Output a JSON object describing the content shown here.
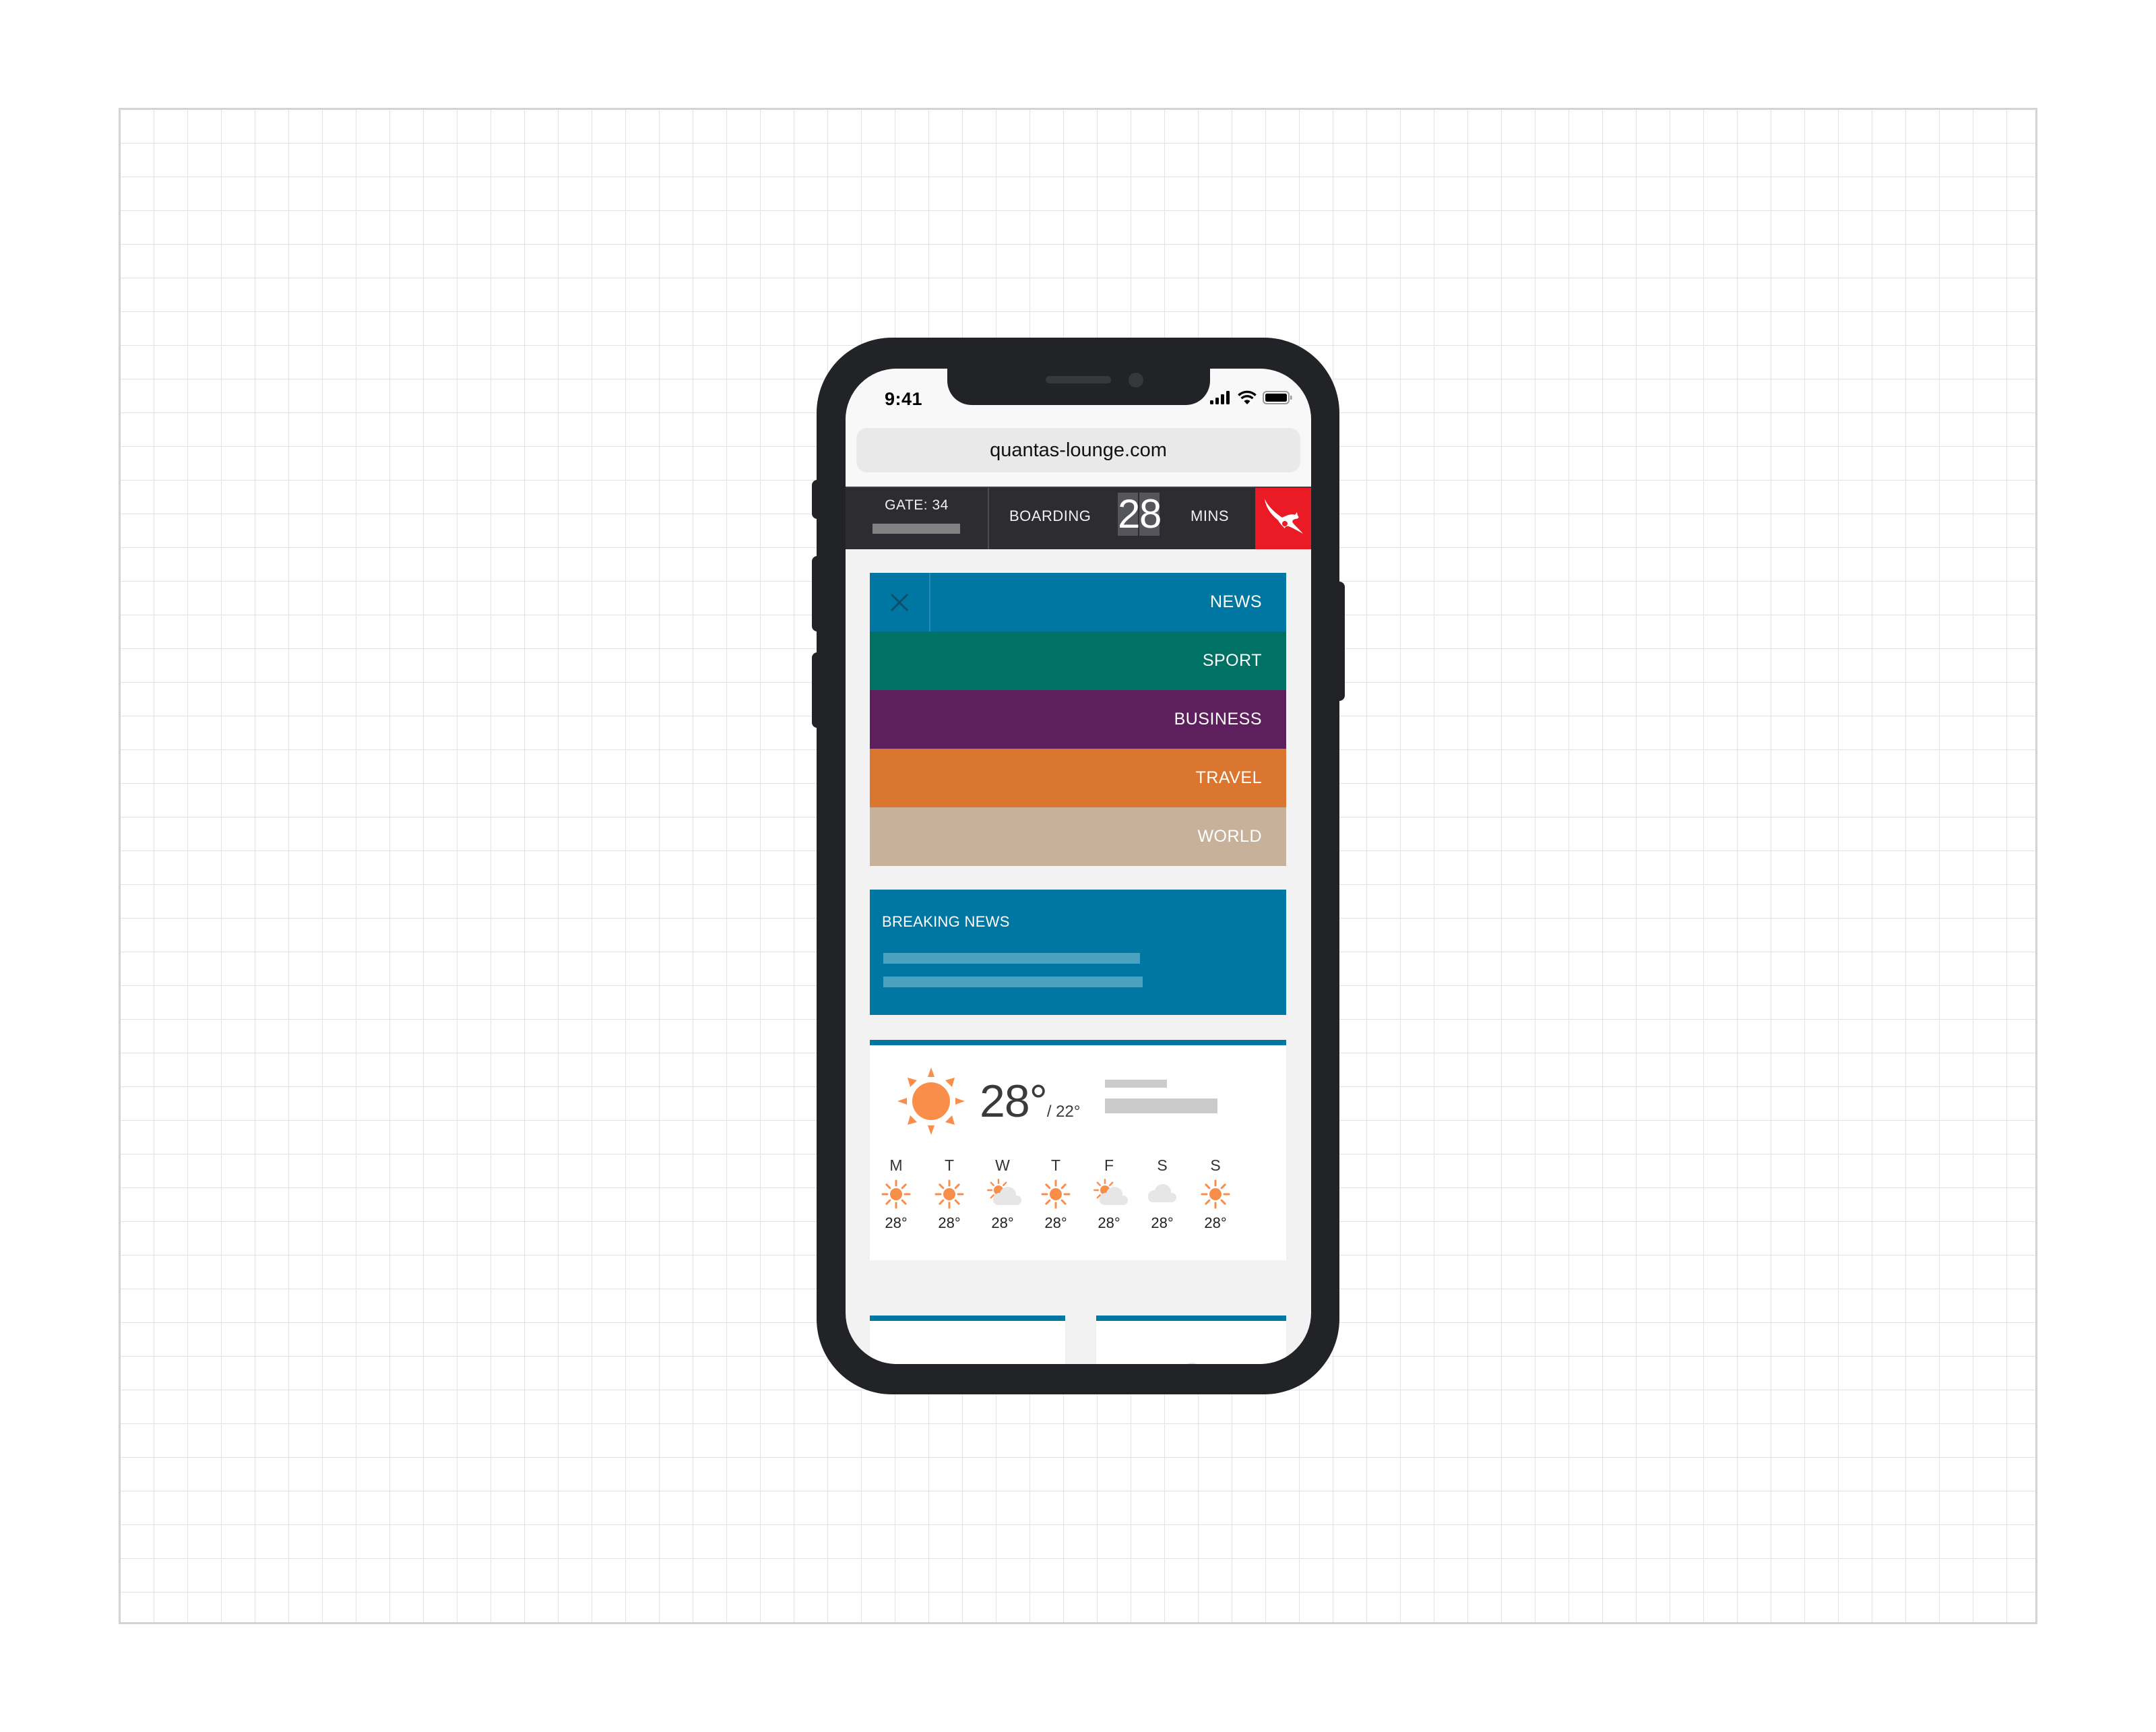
{
  "status_bar": {
    "time": "9:41",
    "icons": [
      "cellular-signal-icon",
      "wifi-icon",
      "battery-icon"
    ]
  },
  "browser": {
    "url": "quantas-lounge.com"
  },
  "flight_header": {
    "gate_label": "GATE: 34",
    "boarding_label": "BOARDING",
    "minutes_digits": [
      "2",
      "8"
    ],
    "mins_label": "MINS",
    "logo": "kangaroo-logo-icon",
    "logo_color": "#ea1b24"
  },
  "menu": {
    "close_icon": "close-icon",
    "items": [
      {
        "label": "NEWS",
        "color": "#0077a3"
      },
      {
        "label": "SPORT",
        "color": "#007165"
      },
      {
        "label": "BUSINESS",
        "color": "#5e1f5d"
      },
      {
        "label": "TRAVEL",
        "color": "#db7631"
      },
      {
        "label": "WORLD",
        "color": "#c8b19a"
      }
    ]
  },
  "breaking_news": {
    "title": "BREAKING NEWS",
    "color": "#0077a3"
  },
  "weather": {
    "current_icon": "sun-icon",
    "current_temp": "28°",
    "low_temp": "/ 22°",
    "forecast": [
      {
        "day": "M",
        "icon": "sun",
        "temp": "28°"
      },
      {
        "day": "T",
        "icon": "sun",
        "temp": "28°"
      },
      {
        "day": "W",
        "icon": "partly-cloudy",
        "temp": "28°"
      },
      {
        "day": "T",
        "icon": "sun",
        "temp": "28°"
      },
      {
        "day": "F",
        "icon": "partly-cloudy",
        "temp": "28°"
      },
      {
        "day": "S",
        "icon": "cloud",
        "temp": "28°"
      },
      {
        "day": "S",
        "icon": "sun",
        "temp": "28°"
      }
    ],
    "sun_color": "#f98e4a",
    "cloud_color": "#e6e6e6"
  },
  "cards": [
    {
      "icon": "mountain-image-icon"
    },
    {
      "icon": "play-video-icon"
    }
  ],
  "theme": {
    "phone_body": "#222327",
    "accent": "#0077a3"
  }
}
